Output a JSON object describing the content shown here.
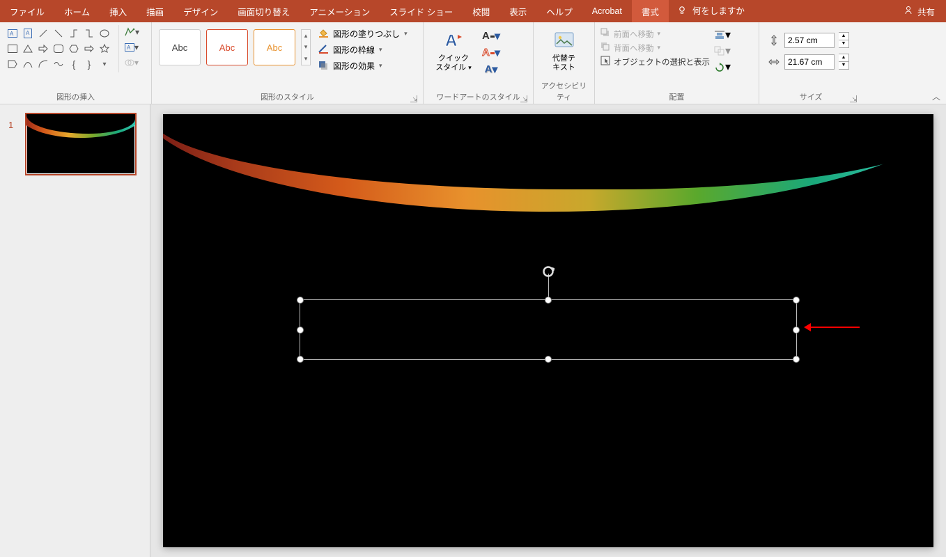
{
  "menu": {
    "tabs": [
      "ファイル",
      "ホーム",
      "挿入",
      "描画",
      "デザイン",
      "画面切り替え",
      "アニメーション",
      "スライド ショー",
      "校閲",
      "表示",
      "ヘルプ",
      "Acrobat",
      "書式"
    ],
    "active": "書式",
    "tell_me_placeholder": "何をしますか",
    "share": "共有"
  },
  "ribbon": {
    "shapes": {
      "label": "図形の挿入"
    },
    "styles": {
      "label": "図形のスタイル",
      "sample": "Abc",
      "fill": "図形の塗りつぶし",
      "outline": "図形の枠線",
      "effects": "図形の効果"
    },
    "wordart": {
      "label": "ワードアートのスタイル",
      "quick_line1": "クイック",
      "quick_line2": "スタイル",
      "glyphA": "A"
    },
    "alttext": {
      "label": "アクセシビリティ",
      "btn_line1": "代替テ",
      "btn_line2": "キスト"
    },
    "arrange": {
      "label": "配置",
      "fwd": "前面へ移動",
      "back": "背面へ移動",
      "selpane": "オブジェクトの選択と表示"
    },
    "size": {
      "label": "サイズ",
      "height": "2.57 cm",
      "width": "21.67 cm"
    }
  },
  "slides": {
    "current": "1"
  }
}
